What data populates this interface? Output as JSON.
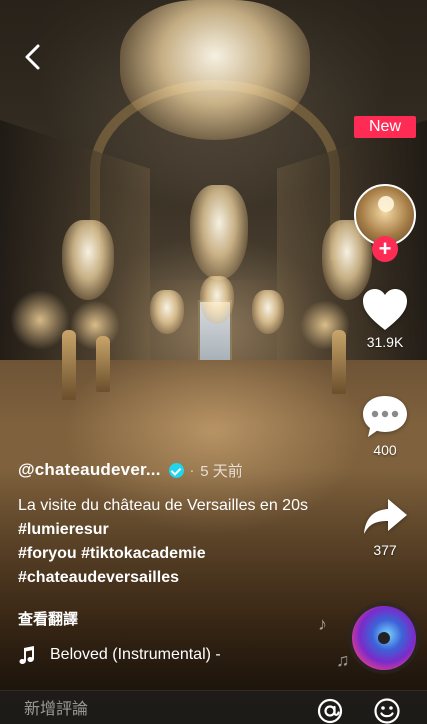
{
  "badge": {
    "new_label": "New"
  },
  "actions": {
    "likes": "31.9K",
    "comments": "400",
    "shares": "377"
  },
  "post": {
    "username": "@chateaudever...",
    "separator": "·",
    "time_ago": "5 天前",
    "caption_text": "La visite du château de Versailles en 20s ",
    "hashtags": [
      "#lumieresur",
      "#foryou",
      "#tiktokacademie",
      "#chateaudeversailles"
    ],
    "translate_label": "查看翻譯",
    "music_title": "Beloved (Instrumental) -"
  },
  "comment_bar": {
    "placeholder": "新增評論"
  },
  "icons": {
    "back": "chevron-left-icon",
    "like": "heart-icon",
    "comment": "speech-bubble-icon",
    "share": "share-arrow-icon",
    "music": "music-note-icon",
    "mention": "at-sign-icon",
    "emoji": "smiley-icon"
  },
  "colors": {
    "accent": "#fe2c55",
    "verified": "#20d5ec"
  }
}
